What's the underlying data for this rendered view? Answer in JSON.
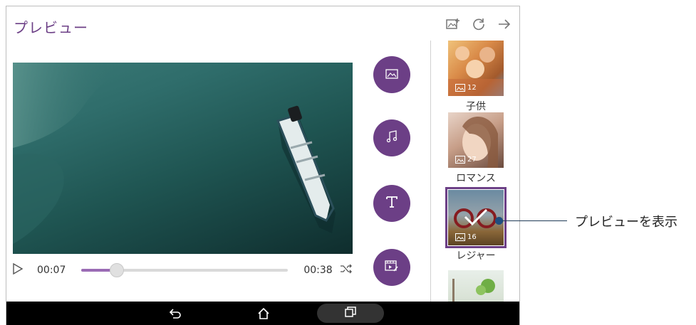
{
  "header": {
    "title": "プレビュー"
  },
  "top_icons": [
    "add-photo-icon",
    "refresh-icon",
    "arrow-right-icon"
  ],
  "playback": {
    "current_time": "00:07",
    "total_time": "00:38",
    "progress": 0.17
  },
  "action_buttons": [
    "image-icon",
    "music-icon",
    "text-icon",
    "video-edit-icon"
  ],
  "themes": [
    {
      "label": "子供",
      "count": "12",
      "selected": false
    },
    {
      "label": "ロマンス",
      "count": "27",
      "selected": false
    },
    {
      "label": "レジャー",
      "count": "16",
      "selected": true
    },
    {
      "label": "",
      "count": "",
      "selected": false
    }
  ],
  "callout": {
    "text": "プレビューを表示"
  },
  "navbar": [
    "back-icon",
    "home-icon",
    "recent-apps-icon"
  ],
  "colors": {
    "accent": "#6c3f86",
    "selected_border": "#6c3f86",
    "water": "#1f5552"
  }
}
